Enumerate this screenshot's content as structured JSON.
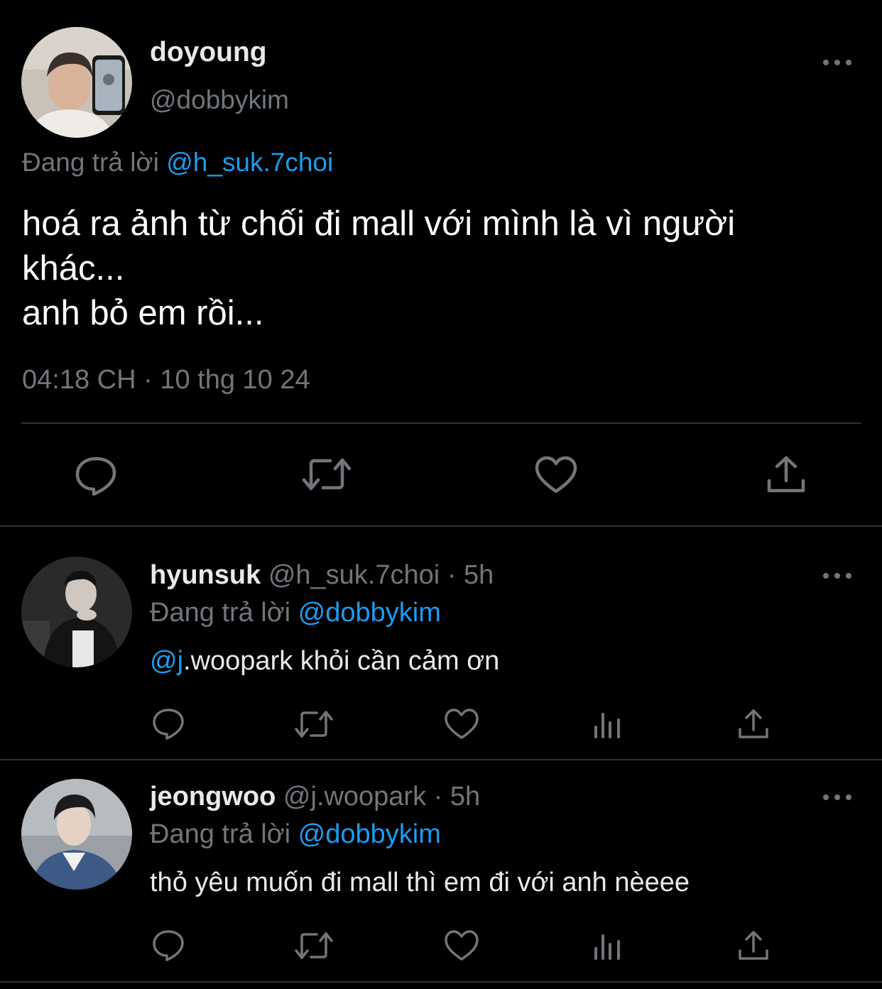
{
  "main_tweet": {
    "display_name": "doyoung",
    "handle": "@dobbykim",
    "reply_prefix": "Đang trả lời",
    "reply_to": "@h_suk.7choi",
    "text_line1": "hoá ra ảnh từ chối đi mall với mình là vì người",
    "text_line2": "khác...",
    "text_line3": "anh bỏ em rồi...",
    "timestamp": "04:18 CH · 10 thg 10 24"
  },
  "replies": [
    {
      "display_name": "hyunsuk",
      "handle": "@h_suk.7choi",
      "time": "· 5h",
      "reply_prefix": "Đang trả lời",
      "reply_to": "@dobbykim",
      "mention": "@j",
      "text": ".woopark khỏi cần cảm ơn"
    },
    {
      "display_name": "jeongwoo",
      "handle": "@j.woopark",
      "time": "· 5h",
      "reply_prefix": "Đang trả lời",
      "reply_to": "@dobbykim",
      "text": "thỏ yêu muốn đi mall thì em đi với anh nèeee"
    }
  ],
  "icons": {
    "reply": "reply-icon",
    "retweet": "retweet-icon",
    "like": "heart-icon",
    "views": "views-icon",
    "share": "share-icon",
    "more": "more-icon"
  },
  "colors": {
    "background": "#000000",
    "text": "#e7e9ea",
    "muted": "#71767b",
    "link": "#1d9bf0",
    "divider": "#2f3336"
  }
}
